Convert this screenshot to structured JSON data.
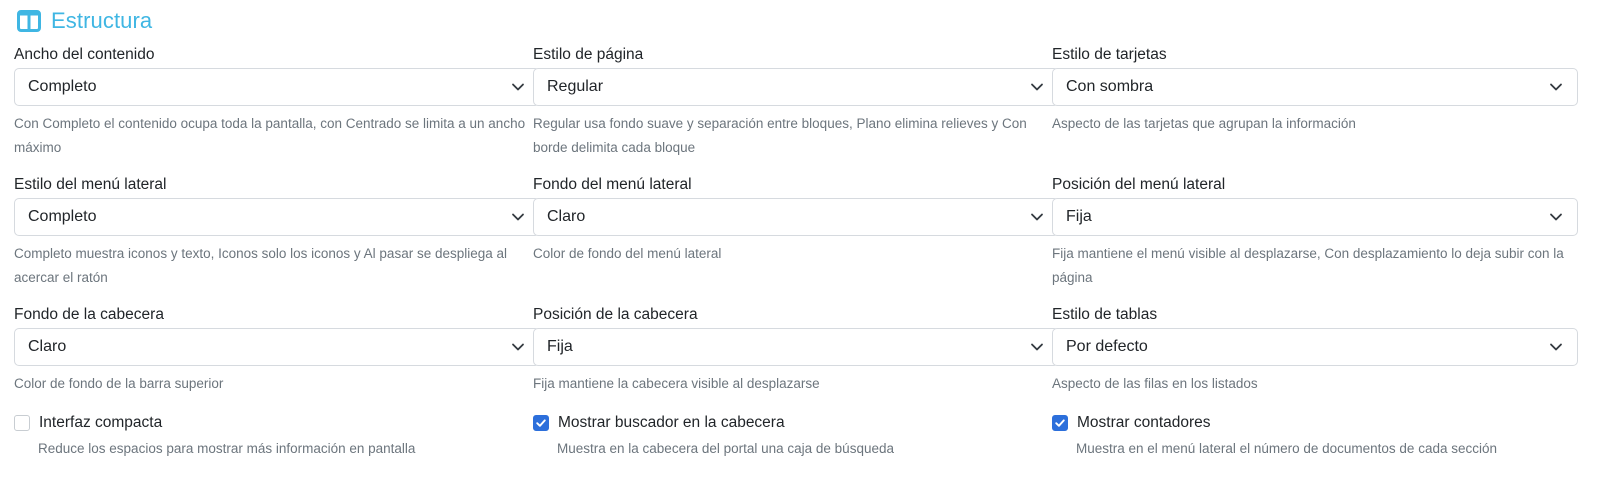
{
  "section": {
    "title": "Estructura",
    "icon": "layout-columns-icon",
    "accent": "#3fb6e3"
  },
  "fields": [
    {
      "label": "Ancho del contenido",
      "value": "Completo",
      "help": "Con Completo el contenido ocupa toda la pantalla, con Centrado se limita a un ancho máximo"
    },
    {
      "label": "Estilo de página",
      "value": "Regular",
      "help": "Regular usa fondo suave y separación entre bloques, Plano elimina relieves y Con borde delimita cada bloque"
    },
    {
      "label": "Estilo de tarjetas",
      "value": "Con sombra",
      "help": "Aspecto de las tarjetas que agrupan la información"
    },
    {
      "label": "Estilo del menú lateral",
      "value": "Completo",
      "help": "Completo muestra iconos y texto, Iconos solo los iconos y Al pasar se despliega al acercar el ratón"
    },
    {
      "label": "Fondo del menú lateral",
      "value": "Claro",
      "help": "Color de fondo del menú lateral"
    },
    {
      "label": "Posición del menú lateral",
      "value": "Fija",
      "help": "Fija mantiene el menú visible al desplazarse, Con desplazamiento lo deja subir con la página"
    },
    {
      "label": "Fondo de la cabecera",
      "value": "Claro",
      "help": "Color de fondo de la barra superior"
    },
    {
      "label": "Posición de la cabecera",
      "value": "Fija",
      "help": "Fija mantiene la cabecera visible al desplazarse"
    },
    {
      "label": "Estilo de tablas",
      "value": "Por defecto",
      "help": "Aspecto de las filas en los listados"
    }
  ],
  "checks": [
    {
      "label": "Interfaz compacta",
      "checked": false,
      "help": "Reduce los espacios para mostrar más información en pantalla"
    },
    {
      "label": "Mostrar buscador en la cabecera",
      "checked": true,
      "help": "Muestra en la cabecera del portal una caja de búsqueda"
    },
    {
      "label": "Mostrar contadores",
      "checked": true,
      "help": "Muestra en el menú lateral el número de documentos de cada sección"
    }
  ],
  "colors": {
    "checkbox_on": "#2c6fdb",
    "help_text": "#6c757d",
    "border": "#d6dadf"
  }
}
